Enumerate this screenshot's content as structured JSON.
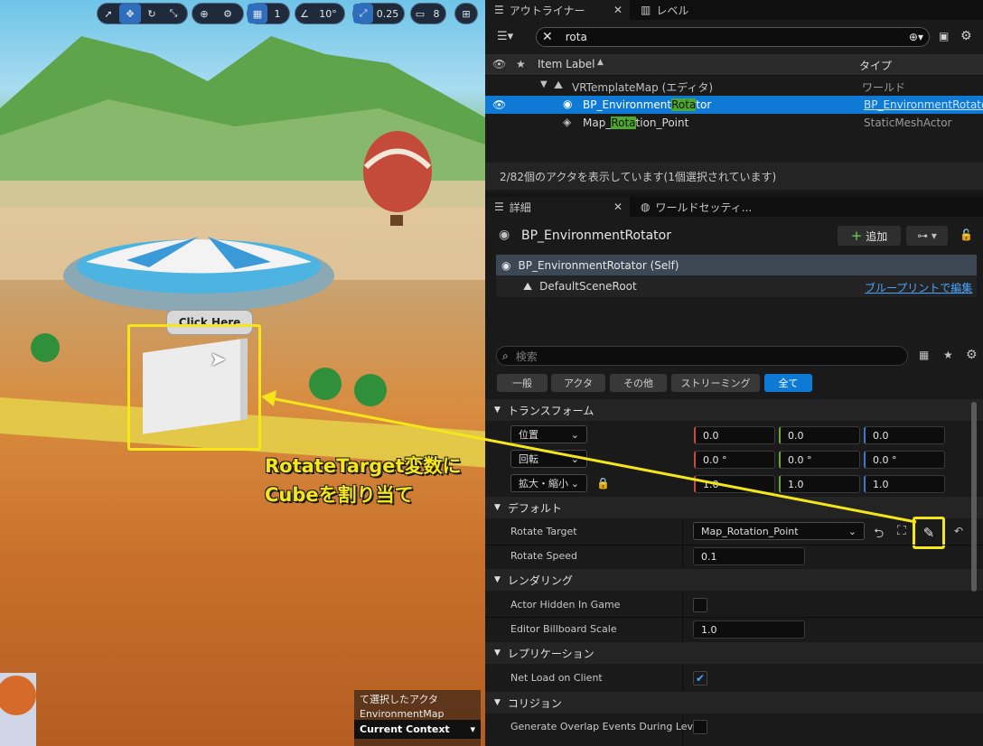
{
  "viewport_toolbar": {
    "snap_grid": "1",
    "angle": "10°",
    "scale": "0.25",
    "camera_speed": "8"
  },
  "viewport": {
    "tooltip": "Click Here",
    "annotation_line1": "RotateTarget変数に",
    "annotation_line2": "Cubeを割り当て",
    "info_line1": "て選択したアクタ",
    "info_line2": "EnvironmentMap",
    "context": "Current Context"
  },
  "outliner": {
    "tab_label": "アウトライナー",
    "tab2_label": "レベル",
    "search_value": "rota",
    "col_label": "Item Label",
    "col_type": "タイプ",
    "rows": [
      {
        "label": "VRTemplateMap (エディタ)",
        "type": "ワールド"
      },
      {
        "label_pre": "BP_Environment",
        "label_hl": "Rota",
        "label_post": "tor",
        "type": "BP_EnvironmentRotato"
      },
      {
        "label_pre": "Map_",
        "label_hl": "Rota",
        "label_post": "tion_Point",
        "type": "StaticMeshActor"
      }
    ],
    "status": "2/82個のアクタを表示しています(1個選択されています)"
  },
  "details": {
    "tab_label": "詳細",
    "tab2_label": "ワールドセッティ...",
    "actor_name": "BP_EnvironmentRotator",
    "add_label": "追加",
    "component_self": "BP_EnvironmentRotator (Self)",
    "component_root": "DefaultSceneRoot",
    "edit_blueprint": "ブループリントで編集",
    "search_placeholder": "検索",
    "filters": [
      "一般",
      "アクタ",
      "その他",
      "ストリーミング",
      "全て"
    ],
    "sections": {
      "transform": "トランスフォーム",
      "default": "デフォルト",
      "rendering": "レンダリング",
      "replication": "レプリケーション",
      "collision": "コリジョン"
    },
    "transform": {
      "location_label": "位置",
      "location": [
        "0.0",
        "0.0",
        "0.0"
      ],
      "rotation_label": "回転",
      "rotation": [
        "0.0 °",
        "0.0 °",
        "0.0 °"
      ],
      "scale_label": "拡大・縮小",
      "scale": [
        "1.0",
        "1.0",
        "1.0"
      ]
    },
    "props": {
      "rotate_target_label": "Rotate Target",
      "rotate_target_value": "Map_Rotation_Point",
      "rotate_speed_label": "Rotate Speed",
      "rotate_speed_value": "0.1",
      "hidden_label": "Actor Hidden In Game",
      "billboard_label": "Editor Billboard Scale",
      "billboard_value": "1.0",
      "netload_label": "Net Load on Client",
      "overlap_label": "Generate Overlap Events During Lev..."
    }
  },
  "colors": {
    "accent": "#0e7ad6",
    "highlight": "#f5e61a",
    "search_hl": "#4fa82e"
  }
}
